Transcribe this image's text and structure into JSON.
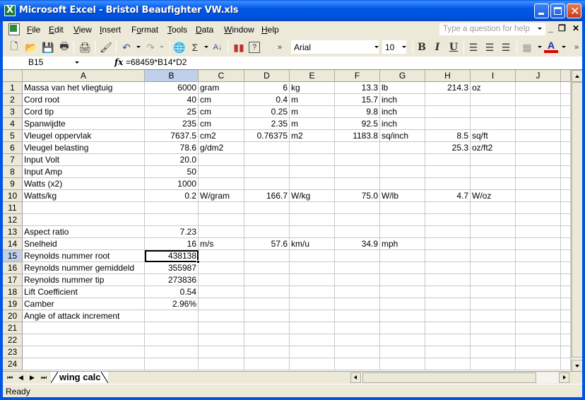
{
  "window": {
    "title": "Microsoft Excel - Bristol Beaufighter VW.xls",
    "controls": [
      "minimize",
      "maximize",
      "close"
    ]
  },
  "menubar": {
    "items": [
      {
        "label": "File",
        "accel": "F"
      },
      {
        "label": "Edit",
        "accel": "E"
      },
      {
        "label": "View",
        "accel": "V"
      },
      {
        "label": "Insert",
        "accel": "I"
      },
      {
        "label": "Format",
        "accel": "o"
      },
      {
        "label": "Tools",
        "accel": "T"
      },
      {
        "label": "Data",
        "accel": "D"
      },
      {
        "label": "Window",
        "accel": "W"
      },
      {
        "label": "Help",
        "accel": "H"
      }
    ],
    "help_placeholder": "Type a question for help"
  },
  "toolbar": {
    "icons": [
      "new-icon",
      "open-icon",
      "save-icon",
      "permission-icon",
      "print-icon",
      "format-painter-icon",
      "undo-icon",
      "redo-icon",
      "hyperlink-icon",
      "autosum-icon",
      "sort-ascending-icon",
      "chart-wizard-icon",
      "help-icon"
    ],
    "font_name": "Arial",
    "font_size": "10",
    "format_buttons": {
      "bold": "B",
      "italic": "I",
      "underline": "U"
    },
    "sigma": "Σ",
    "more": "»"
  },
  "formula_bar": {
    "name_box": "B15",
    "fx_label": "fx",
    "formula": "=68459*B14*D2"
  },
  "grid": {
    "columns": [
      "A",
      "B",
      "C",
      "D",
      "E",
      "F",
      "G",
      "H",
      "I",
      "J"
    ],
    "selected_column": "B",
    "selected_row": 15,
    "active_cell": "B15",
    "rows": [
      {
        "n": "1",
        "A": "Massa van het vliegtuig",
        "B": "6000",
        "C": "gram",
        "D": "6",
        "E": "kg",
        "F": "13.3",
        "G": "lb",
        "H": "214.3",
        "I": "oz"
      },
      {
        "n": "2",
        "A": "Cord root",
        "B": "40",
        "C": "cm",
        "D": "0.4",
        "E": "m",
        "F": "15.7",
        "G": "inch"
      },
      {
        "n": "3",
        "A": "Cord tip",
        "B": "25",
        "C": "cm",
        "D": "0.25",
        "E": "m",
        "F": "9.8",
        "G": "inch"
      },
      {
        "n": "4",
        "A": "Spanwijdte",
        "B": "235",
        "C": "cm",
        "D": "2.35",
        "E": "m",
        "F": "92.5",
        "G": "inch"
      },
      {
        "n": "5",
        "A": "Vleugel oppervlak",
        "B": "7637.5",
        "C": "cm2",
        "D": "0.76375",
        "E": "m2",
        "F": "1183.8",
        "G": "sq/inch",
        "H": "8.5",
        "I": "sq/ft"
      },
      {
        "n": "6",
        "A": "Vleugel belasting",
        "B": "78.6",
        "C": "g/dm2",
        "H": "25.3",
        "I": "oz/ft2"
      },
      {
        "n": "7",
        "A": "Input Volt",
        "B": "20.0"
      },
      {
        "n": "8",
        "A": "Input Amp",
        "B": "50"
      },
      {
        "n": "9",
        "A": "Watts (x2)",
        "B": "1000"
      },
      {
        "n": "10",
        "A": "Watts/kg",
        "B": "0.2",
        "C": "W/gram",
        "D": "166.7",
        "E": "W/kg",
        "F": "75.0",
        "G": "W/lb",
        "H": "4.7",
        "I": "W/oz"
      },
      {
        "n": "11"
      },
      {
        "n": "12"
      },
      {
        "n": "13",
        "A": "Aspect ratio",
        "B": "7.23"
      },
      {
        "n": "14",
        "A": "Snelheid",
        "B": "16",
        "C": "m/s",
        "D": "57.6",
        "E": "km/u",
        "F": "34.9",
        "G": "mph"
      },
      {
        "n": "15",
        "A": "Reynolds nummer root",
        "B": "438138"
      },
      {
        "n": "16",
        "A": "Reynolds nummer gemiddeld",
        "B": "355987"
      },
      {
        "n": "17",
        "A": "Reynolds nummer tip",
        "B": "273836"
      },
      {
        "n": "18",
        "A": "Lift Coefficient",
        "B": "0.54"
      },
      {
        "n": "19",
        "A": "Camber",
        "B": "2.96%"
      },
      {
        "n": "20",
        "A": "Angle of attack increment"
      },
      {
        "n": "21"
      },
      {
        "n": "22"
      },
      {
        "n": "23"
      },
      {
        "n": "24"
      }
    ]
  },
  "sheets": {
    "tabs": [
      "wing calc"
    ],
    "active": "wing calc"
  },
  "status": {
    "text": "Ready"
  }
}
